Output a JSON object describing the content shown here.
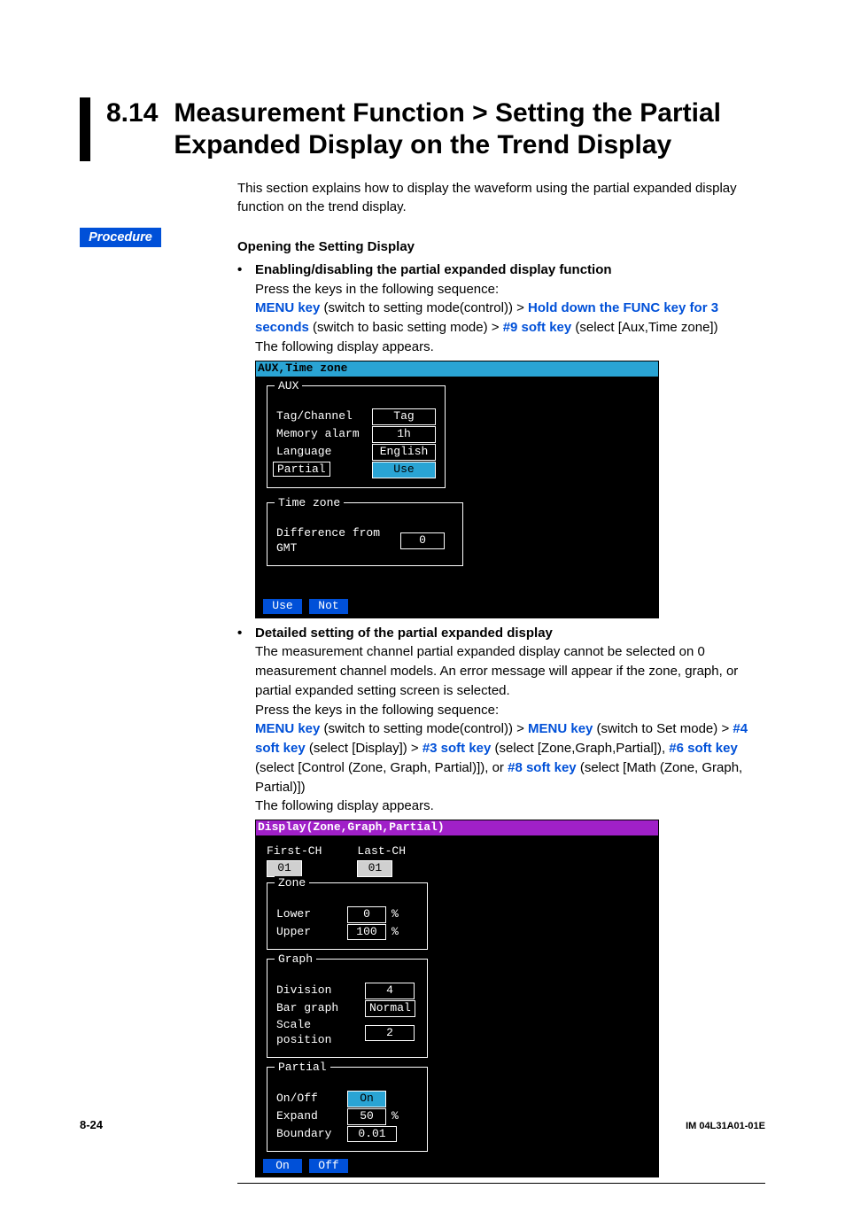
{
  "section": {
    "number": "8.14",
    "title_line1": "Measurement Function > Setting the Partial",
    "title_line2": "Expanded Display on the Trend Display"
  },
  "intro": "This section explains how to display the waveform using the partial expanded display function on the trend display.",
  "procedure_label": "Procedure",
  "subhead_opening": "Opening the Setting Display",
  "bullet1": {
    "title": "Enabling/disabling the partial expanded display function",
    "press": "Press the keys in the following sequence:",
    "seq": {
      "k1": "MENU key",
      "t1": " (switch to setting mode(control)) > ",
      "k2": "Hold down the FUNC key for 3 seconds",
      "t2": " (switch to basic setting mode) > ",
      "k3": "#9 soft key",
      "t3": " (select [Aux,Time zone])"
    },
    "following": "The following display appears."
  },
  "screenshot1": {
    "titlebar": "AUX,Time zone",
    "aux_legend": "AUX",
    "rows": {
      "tag_channel": {
        "label": "Tag/Channel",
        "value": "Tag"
      },
      "memory_alarm": {
        "label": "Memory alarm",
        "value": "1h"
      },
      "language": {
        "label": "Language",
        "value": "English"
      },
      "partial": {
        "label": "Partial",
        "value": "Use"
      }
    },
    "tz_legend": "Time zone",
    "tz_row": {
      "label": "Difference from GMT",
      "value": "0"
    },
    "softkeys": {
      "use": "Use",
      "not": "Not"
    }
  },
  "bullet2": {
    "title": "Detailed setting of the partial expanded display",
    "para1": "The measurement channel partial expanded display cannot be selected on 0 measurement channel models.  An error message will appear if the zone, graph, or partial expanded setting screen is selected.",
    "press": "Press the keys in the following sequence:",
    "seq": {
      "k1": "MENU key",
      "t1": " (switch to setting mode(control)) > ",
      "k2": "MENU key",
      "t2": " (switch to Set mode) > ",
      "k3": "#4 soft key",
      "t3": " (select [Display]) > ",
      "k4": "#3 soft key",
      "t4": " (select [Zone,Graph,Partial]), ",
      "k5": "#6 soft key",
      "t5": " (select [Control (Zone, Graph, Partial)]), or ",
      "k6": "#8 soft key",
      "t6": " (select [Math (Zone, Graph, Partial)])"
    },
    "following": "The following display appears."
  },
  "screenshot2": {
    "titlebar": "Display(Zone,Graph,Partial)",
    "first_ch": {
      "label": "First-CH",
      "value": "01"
    },
    "last_ch": {
      "label": "Last-CH",
      "value": "01"
    },
    "zone_legend": "Zone",
    "zone": {
      "lower": {
        "label": "Lower",
        "value": "0",
        "unit": "%"
      },
      "upper": {
        "label": "Upper",
        "value": "100",
        "unit": "%"
      }
    },
    "graph_legend": "Graph",
    "graph": {
      "division": {
        "label": "Division",
        "value": "4"
      },
      "bar_graph": {
        "label": "Bar graph",
        "value": "Normal"
      },
      "scale_pos": {
        "label": "Scale position",
        "value": "2"
      }
    },
    "partial_legend": "Partial",
    "partial": {
      "onoff": {
        "label": "On/Off",
        "value": "On"
      },
      "expand": {
        "label": "Expand",
        "value": "50",
        "unit": "%"
      },
      "boundary": {
        "label": "Boundary",
        "value": "0.01"
      }
    },
    "softkeys": {
      "on": "On",
      "off": "Off"
    }
  },
  "page_number": "8-24",
  "doc_id": "IM 04L31A01-01E"
}
